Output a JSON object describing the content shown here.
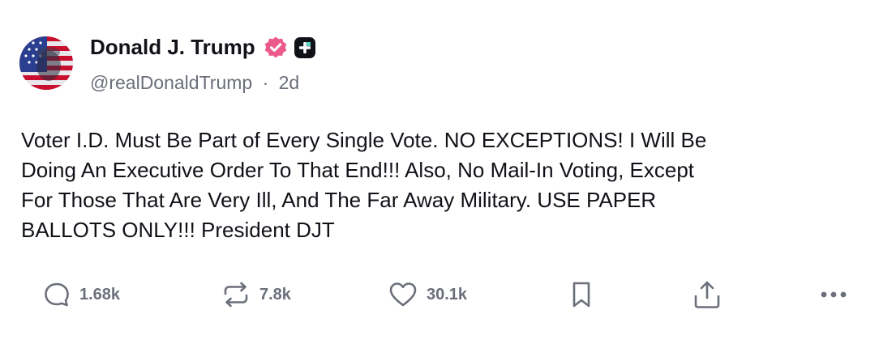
{
  "author": {
    "name": "Donald J. Trump",
    "handle": "@realDonaldTrump",
    "separator": "·",
    "time": "2d",
    "verified_icon": "verified-badge-icon",
    "plus_icon": "plus-badge-icon",
    "colors": {
      "verified": "#ec5a8c",
      "plus_badge": "#111218"
    }
  },
  "post": {
    "lines": [
      "Voter I.D. Must Be Part of Every Single Vote. NO EXCEPTIONS! I Will Be",
      "Doing An Executive Order To That End!!! Also, No Mail-In Voting, Except",
      "For Those That Are Very Ill, And The Far Away Military. USE PAPER",
      "BALLOTS ONLY!!! President DJT"
    ]
  },
  "actions": {
    "reply": {
      "icon": "reply-icon",
      "count": "1.68k"
    },
    "repost": {
      "icon": "repost-icon",
      "count": "7.8k"
    },
    "like": {
      "icon": "heart-icon",
      "count": "30.1k"
    },
    "bookmark": {
      "icon": "bookmark-icon"
    },
    "share": {
      "icon": "share-icon"
    },
    "more": {
      "icon": "more-icon"
    }
  }
}
